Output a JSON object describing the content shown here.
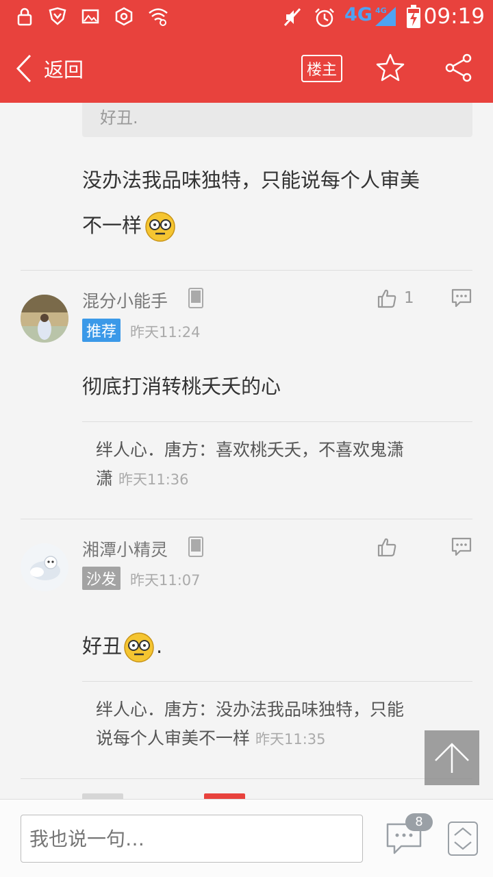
{
  "status_bar": {
    "network": "4G",
    "time": "09:19"
  },
  "header": {
    "back_label": "返回",
    "op_button_label": "楼主"
  },
  "colors": {
    "brand_red": "#e8423d",
    "badge_recommend": "#3b99e8",
    "badge_sofa": "#a3a3a3"
  },
  "thread": {
    "quote_top": "好丑.",
    "top_body_line1": "没办法我品味独特，只能说每个人审美",
    "top_body_line2": "不一样",
    "comments": [
      {
        "username": "混分小能手",
        "badge": "推荐",
        "time": "昨天11:24",
        "likes": "1",
        "body": "彻底打消转桃夭夭的心",
        "reply": {
          "text_line1": "绊人心．唐方：喜欢桃夭夭，不喜欢鬼潇",
          "text_line2": "潇",
          "time": "昨天11:36"
        }
      },
      {
        "username": "湘潭小精灵",
        "badge": "沙发",
        "time": "昨天11:07",
        "body": "好丑",
        "body_suffix": ".",
        "reply": {
          "text_line1": "绊人心．唐方：没办法我品味独特，只能",
          "text_line2": "说每个人审美不一样",
          "time": "昨天11:35"
        }
      }
    ]
  },
  "bottom_bar": {
    "input_placeholder": "我也说一句…",
    "comment_count": "8"
  }
}
